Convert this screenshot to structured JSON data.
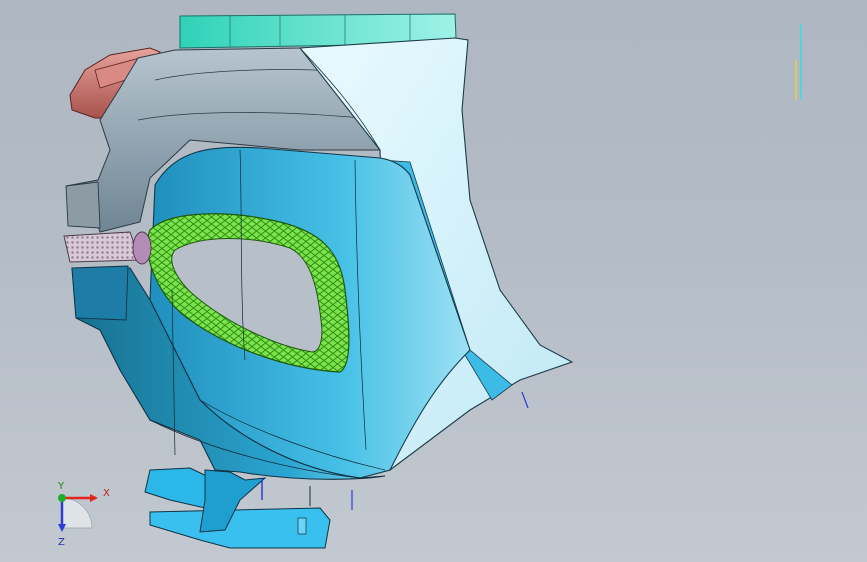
{
  "viewport": {
    "background_top": "#aeb7c2",
    "background_bottom": "#c3c9d0"
  },
  "model": {
    "colors": {
      "upper_panel": "#7fe8d2",
      "upper_panel_dark": "#1fc4b0",
      "light_body": "#d6f2f8",
      "mid_body": "#3ab6dc",
      "dark_body": "#1c88b2",
      "grey_housing": "#94a6b2",
      "red_bracket": "#c9736c",
      "mesh_green": "#76e04a",
      "mesh_dark": "#3a9a1c",
      "bracket_blue": "#2bb8e8"
    }
  },
  "triad": {
    "x_label": "X",
    "y_label": "Y",
    "z_label": "Z",
    "x_color": "#e0261b",
    "y_color": "#1fae2a",
    "z_color": "#2a3fd6"
  },
  "indicator": {
    "cyan_line_color": "#3fd8e8",
    "yellow_line_color": "#e6d23c"
  }
}
